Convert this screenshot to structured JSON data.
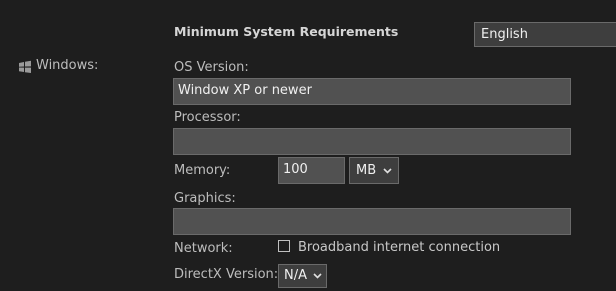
{
  "header": {
    "title": "Minimum System Requirements",
    "language_selected": "English"
  },
  "platform": {
    "label": "Windows:",
    "icon": "windows-icon"
  },
  "fields": {
    "os_label": "OS Version:",
    "os_value": "Window XP or newer",
    "processor_label": "Processor:",
    "processor_value": "",
    "memory_label": "Memory:",
    "memory_value": "100",
    "memory_unit": "MB",
    "graphics_label": "Graphics:",
    "graphics_value": "",
    "network_label": "Network:",
    "network_checkbox_label": "Broadband internet connection",
    "network_checked": false,
    "directx_label": "DirectX Version:",
    "directx_value": "N/A"
  },
  "colors": {
    "background": "#1e1e1e",
    "field_bg": "#515151",
    "select_bg": "#3e3e3e"
  }
}
